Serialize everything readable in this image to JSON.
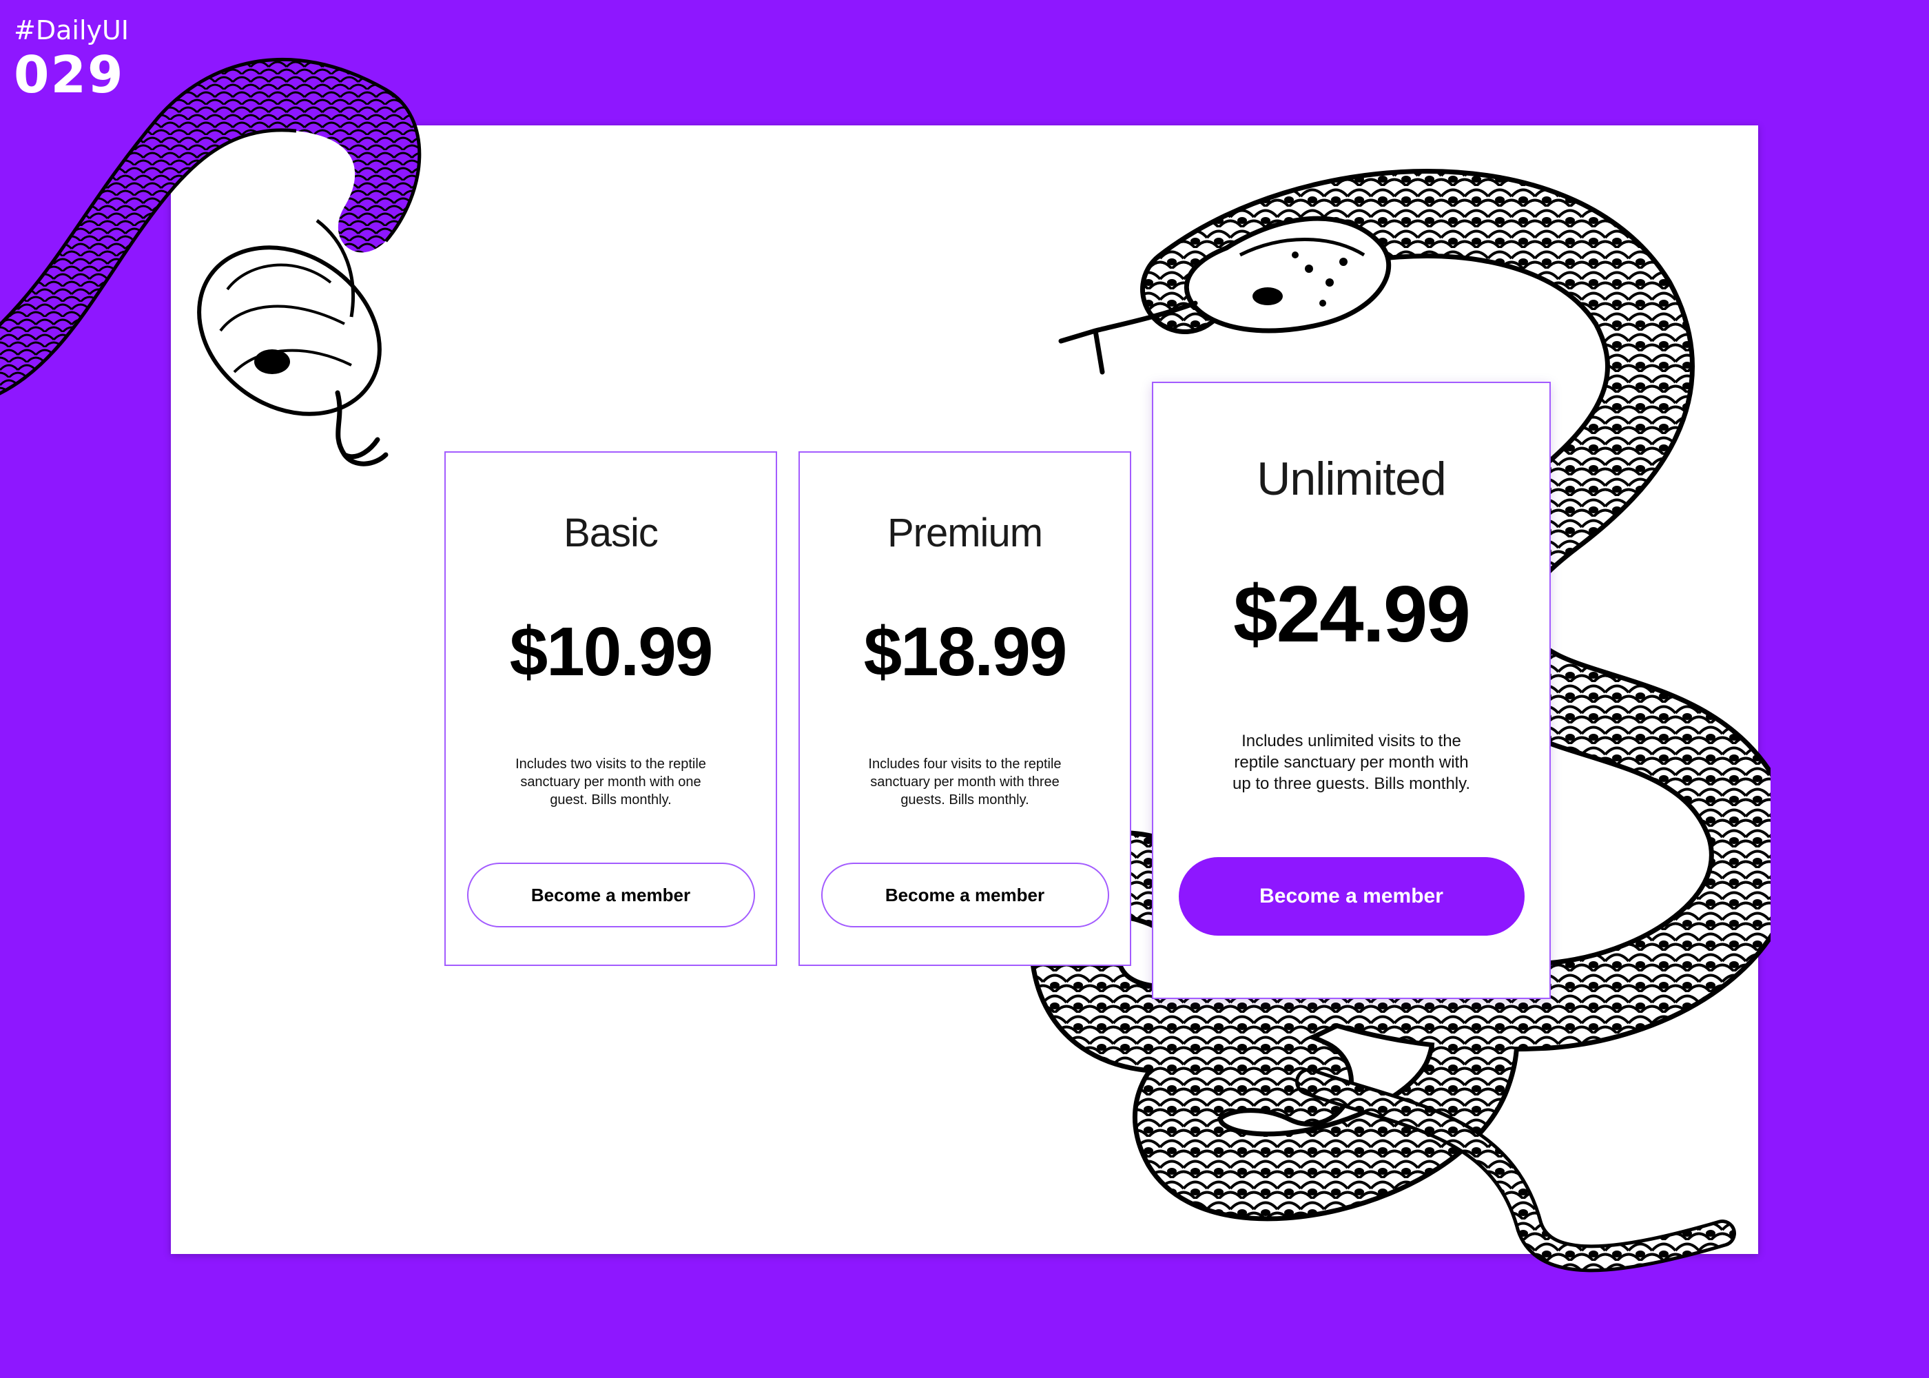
{
  "header": {
    "hashtag": "#DailyUI",
    "number": "029"
  },
  "colors": {
    "accent": "#8e17ff",
    "card_border": "#a35cff",
    "background": "#ffffff"
  },
  "plans": [
    {
      "name": "Basic",
      "price": "$10.99",
      "description": "Includes two visits to the reptile sanctuary per month with one guest. Bills monthly.",
      "cta": "Become a member",
      "highlighted": false
    },
    {
      "name": "Premium",
      "price": "$18.99",
      "description": "Includes four visits to the reptile sanctuary per month with three guests. Bills monthly.",
      "cta": "Become a member",
      "highlighted": false
    },
    {
      "name": "Unlimited",
      "price": "$24.99",
      "description": "Includes unlimited visits to the reptile sanctuary per month with up to three guests. Bills monthly.",
      "cta": "Become a member",
      "highlighted": true
    }
  ],
  "illustrations": [
    "snake-illustration-left",
    "snake-illustration-right"
  ]
}
